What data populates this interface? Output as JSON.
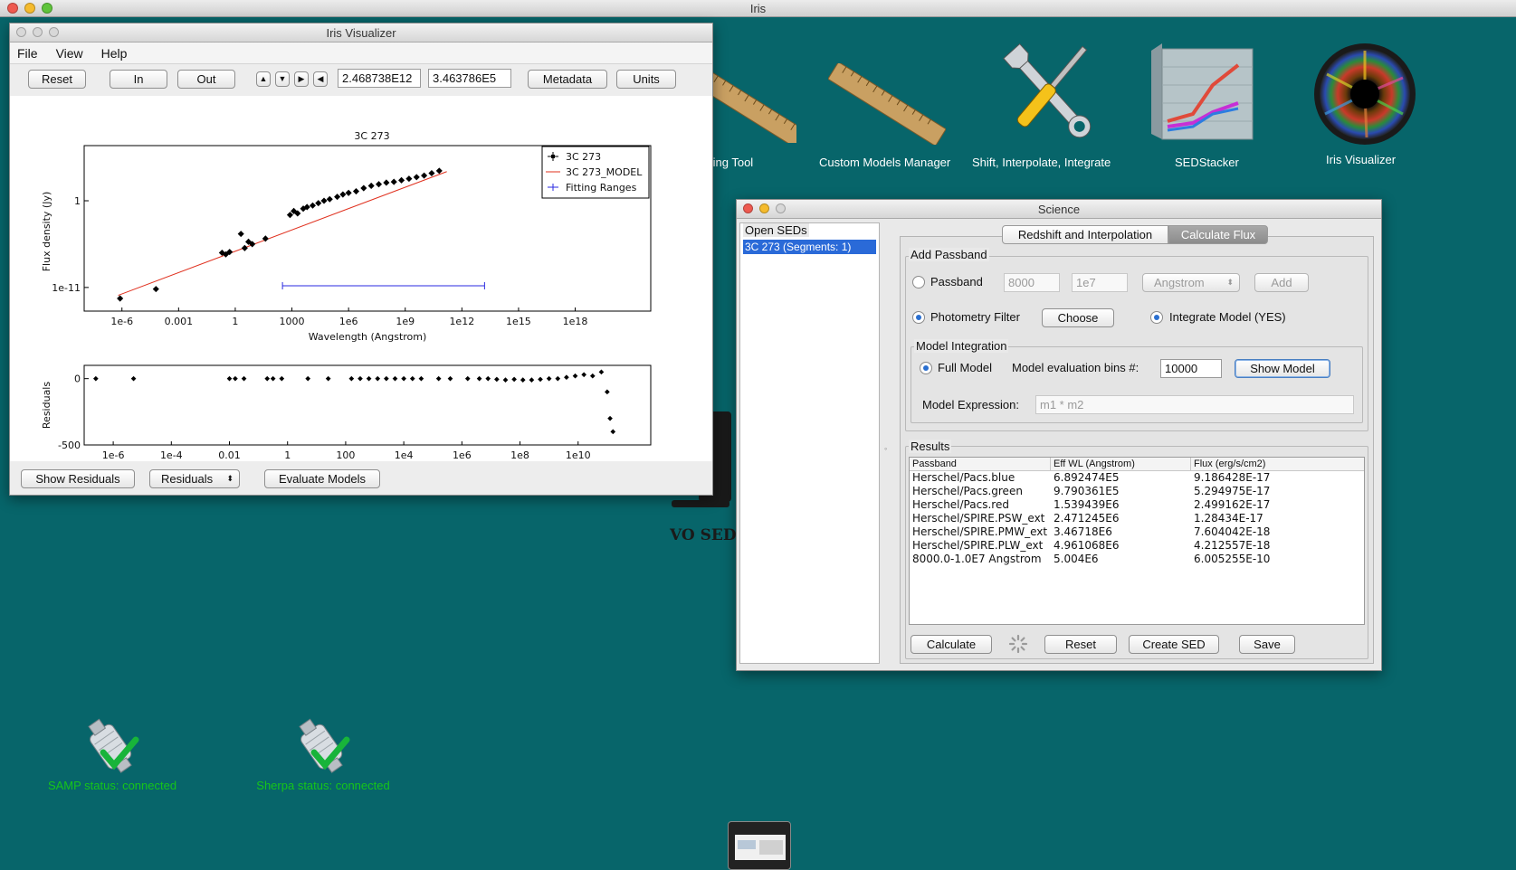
{
  "app": {
    "title": "Iris"
  },
  "desktop": {
    "icons": [
      {
        "id": "fitting",
        "label": "ting Tool",
        "icon": "ruler-icon"
      },
      {
        "id": "custom_models",
        "label": "Custom Models Manager",
        "icon": "ruler-icon"
      },
      {
        "id": "shift",
        "label": "Shift, Interpolate, Integrate",
        "icon": "tools-icon"
      },
      {
        "id": "sedstacker",
        "label": "SEDStacker",
        "icon": "chart-icon"
      },
      {
        "id": "visualizer",
        "label": "Iris Visualizer",
        "icon": "eye-icon"
      }
    ],
    "background_logo": "VO SED",
    "status": [
      {
        "label": "SAMP status: connected",
        "color": "#16c51a"
      },
      {
        "label": "Sherpa status: connected",
        "color": "#16c51a"
      }
    ]
  },
  "visualizer": {
    "title": "Iris Visualizer",
    "menu": [
      "File",
      "View",
      "Help"
    ],
    "toolbar": {
      "reset": "Reset",
      "in": "In",
      "out": "Out",
      "x_value": "2.468738E12",
      "y_value": "3.463786E5",
      "metadata": "Metadata",
      "units": "Units"
    },
    "bottom": {
      "show_residuals": "Show Residuals",
      "residuals_select": "Residuals",
      "evaluate_models": "Evaluate Models"
    }
  },
  "science": {
    "title": "Science",
    "open_seds_label": "Open SEDs",
    "sed_items": [
      "3C 273 (Segments: 1)"
    ],
    "tabs": [
      "Redshift and Interpolation",
      "Calculate Flux"
    ],
    "add_passband": {
      "label": "Add Passband",
      "passband": "Passband",
      "min": "8000",
      "max": "1e7",
      "unit": "Angstrom",
      "add": "Add",
      "photometry_filter": "Photometry Filter",
      "choose": "Choose",
      "integrate_model": "Integrate Model (YES)"
    },
    "model_integration": {
      "label": "Model Integration",
      "full_model": "Full Model",
      "bins_label": "Model evaluation bins #:",
      "bins_value": "10000",
      "show_model": "Show Model",
      "expression_label": "Model Expression:",
      "expression_placeholder": "m1 * m2"
    },
    "results": {
      "label": "Results",
      "columns": [
        "Passband",
        "Eff WL (Angstrom)",
        "Flux (erg/s/cm2)"
      ],
      "rows": [
        [
          "Herschel/Pacs.blue",
          "6.892474E5",
          "9.186428E-17"
        ],
        [
          "Herschel/Pacs.green",
          "9.790361E5",
          "5.294975E-17"
        ],
        [
          "Herschel/Pacs.red",
          "1.539439E6",
          "2.499162E-17"
        ],
        [
          "Herschel/SPIRE.PSW_ext",
          "2.471245E6",
          "1.28434E-17"
        ],
        [
          "Herschel/SPIRE.PMW_ext",
          "3.46718E6",
          "7.604042E-18"
        ],
        [
          "Herschel/SPIRE.PLW_ext",
          "4.961068E6",
          "4.212557E-18"
        ],
        [
          "8000.0-1.0E7 Angstrom",
          "5.004E6",
          "6.005255E-10"
        ]
      ]
    },
    "actions": {
      "calculate": "Calculate",
      "reset": "Reset",
      "create_sed": "Create SED",
      "save": "Save"
    }
  },
  "chart_data": [
    {
      "type": "scatter",
      "title": "3C 273",
      "xlabel": "Wavelength (Angstrom)",
      "ylabel": "Flux density (Jy)",
      "x_scale": "log",
      "y_scale": "log",
      "x_ticks": [
        "1e-6",
        "0.001",
        "1",
        "1000",
        "1e6",
        "1e9",
        "1e12",
        "1e15",
        "1e18"
      ],
      "y_ticks": [
        "1",
        "1e-11"
      ],
      "legend": [
        "3C 273",
        "3C 273_MODEL",
        "Fitting Ranges"
      ],
      "legend_position": "top-right",
      "series": [
        {
          "name": "3C 273",
          "color": "#000000",
          "x_log10": [
            -6.1,
            -4.2,
            -0.7,
            -0.5,
            -0.3,
            0.3,
            0.5,
            0.7,
            0.9,
            1.6,
            2.9,
            3.1,
            3.3,
            3.6,
            3.8,
            4.1,
            4.4,
            4.7,
            5.0,
            5.4,
            5.7,
            6.0,
            6.4,
            6.8,
            7.2,
            7.6,
            8.0,
            8.4,
            8.8,
            9.2,
            9.6,
            10.0,
            10.4,
            10.8
          ],
          "y_log10": [
            -12.4,
            -11.2,
            -6.6,
            -6.8,
            -6.5,
            -4.2,
            -6.0,
            -5.2,
            -5.5,
            -4.8,
            -1.8,
            -1.3,
            -1.6,
            -1.0,
            -0.8,
            -0.6,
            -0.3,
            0.0,
            0.2,
            0.5,
            0.8,
            1.0,
            1.2,
            1.6,
            1.9,
            2.1,
            2.3,
            2.4,
            2.6,
            2.8,
            3.0,
            3.2,
            3.5,
            3.8
          ]
        },
        {
          "name": "3C 273_MODEL",
          "color": "#e0301e",
          "x_log10": [
            -6.2,
            11.2
          ],
          "y_log10": [
            -12.0,
            3.7
          ]
        }
      ],
      "fitting_range_log10": [
        2.5,
        13.2
      ]
    },
    {
      "type": "scatter",
      "ylabel": "Residuals",
      "x_scale": "log",
      "x_ticks": [
        "1e-6",
        "1e-4",
        "0.01",
        "1",
        "100",
        "1e4",
        "1e6",
        "1e8",
        "1e10"
      ],
      "y_ticks": [
        "0",
        "-500"
      ],
      "series": [
        {
          "name": "Residuals",
          "color": "#000000",
          "x_log10": [
            -6.6,
            -5.3,
            -2.0,
            -1.8,
            -1.5,
            -0.7,
            -0.5,
            -0.2,
            0.7,
            1.4,
            2.2,
            2.5,
            2.8,
            3.1,
            3.4,
            3.7,
            4.0,
            4.3,
            4.6,
            5.2,
            5.6,
            6.2,
            6.6,
            6.9,
            7.2,
            7.5,
            7.8,
            8.1,
            8.4,
            8.7,
            9.0,
            9.3,
            9.6,
            9.9,
            10.2,
            10.5,
            10.8,
            11.0,
            11.1,
            11.2
          ],
          "y_value": [
            0,
            0,
            0,
            0,
            0,
            0,
            0,
            0,
            0,
            0,
            0,
            0,
            0,
            0,
            0,
            0,
            0,
            0,
            0,
            0,
            0,
            0,
            0,
            0,
            -5,
            -10,
            -5,
            -10,
            -10,
            -5,
            0,
            0,
            10,
            20,
            30,
            20,
            50,
            -100,
            -300,
            -400
          ]
        }
      ]
    }
  ]
}
